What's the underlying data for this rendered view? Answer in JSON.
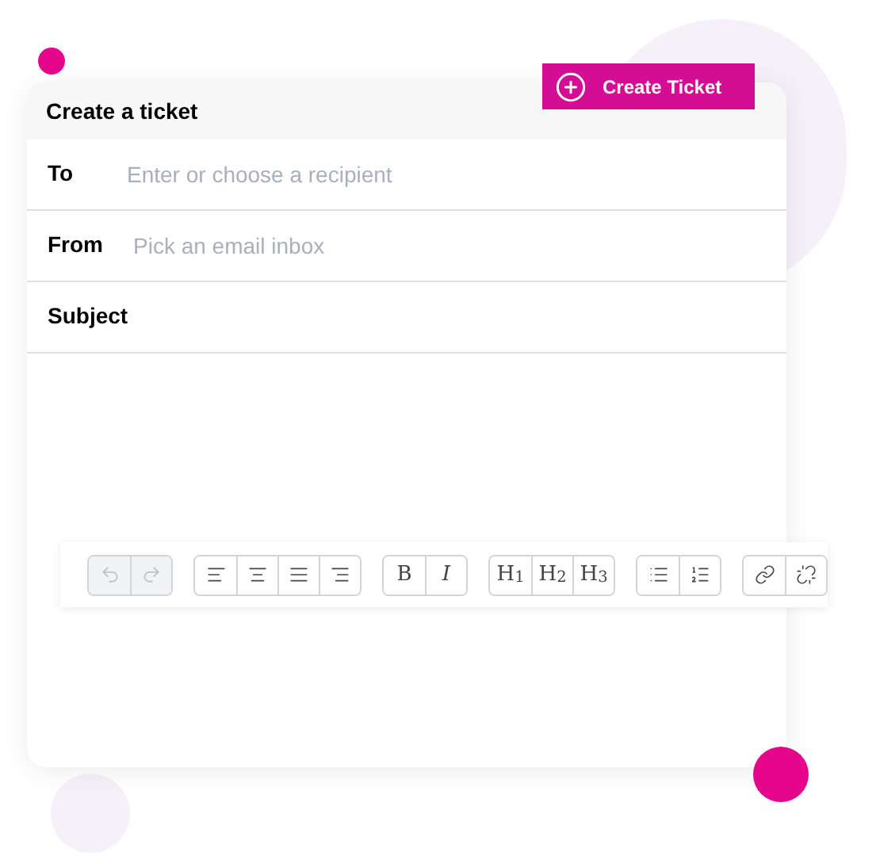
{
  "card": {
    "title": "Create a ticket"
  },
  "create_button": {
    "label": "Create Ticket"
  },
  "fields": [
    {
      "label": "To",
      "placeholder": "Enter or choose a recipient"
    },
    {
      "label": "From",
      "placeholder": "Pick an email inbox"
    },
    {
      "label": "Subject"
    }
  ],
  "toolbar": [
    [
      {
        "kind": "undo",
        "disabled": true
      },
      {
        "kind": "redo",
        "disabled": true
      }
    ],
    [
      {
        "kind": "align-left",
        "disabled": false
      },
      {
        "kind": "align-center",
        "disabled": false
      },
      {
        "kind": "align-justify",
        "disabled": false
      },
      {
        "kind": "align-right",
        "disabled": false
      }
    ],
    [
      {
        "kind": "text",
        "label": "B",
        "disabled": false
      },
      {
        "kind": "text-italic",
        "label": "I",
        "disabled": false
      }
    ],
    [
      {
        "kind": "text",
        "label": "H$_{1}$",
        "disabled": false
      },
      {
        "kind": "text",
        "label": "H$_{2}$",
        "disabled": false
      },
      {
        "kind": "text",
        "label": "H$_{3}$",
        "disabled": false
      }
    ],
    [
      {
        "kind": "bullet-list",
        "disabled": false
      },
      {
        "kind": "numbered-list",
        "disabled": false
      }
    ],
    [
      {
        "kind": "link",
        "disabled": false
      },
      {
        "kind": "unlink",
        "disabled": false
      }
    ]
  ]
}
